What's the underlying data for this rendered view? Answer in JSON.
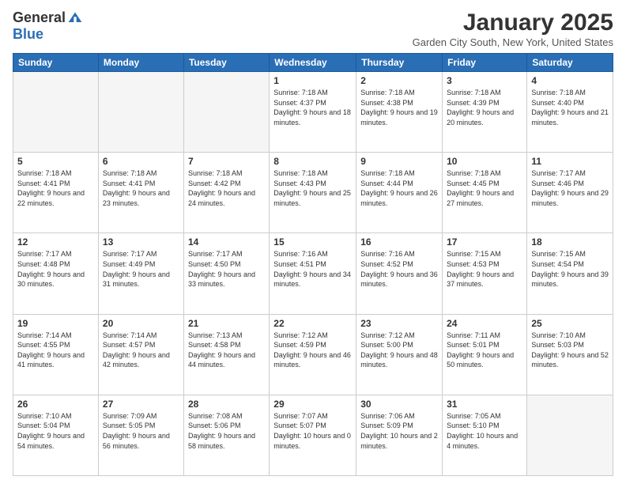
{
  "header": {
    "logo_general": "General",
    "logo_blue": "Blue",
    "month_title": "January 2025",
    "location": "Garden City South, New York, United States"
  },
  "weekdays": [
    "Sunday",
    "Monday",
    "Tuesday",
    "Wednesday",
    "Thursday",
    "Friday",
    "Saturday"
  ],
  "weeks": [
    [
      {
        "day": "",
        "empty": true
      },
      {
        "day": "",
        "empty": true
      },
      {
        "day": "",
        "empty": true
      },
      {
        "day": "1",
        "sunrise": "7:18 AM",
        "sunset": "4:37 PM",
        "daylight": "9 hours and 18 minutes."
      },
      {
        "day": "2",
        "sunrise": "7:18 AM",
        "sunset": "4:38 PM",
        "daylight": "9 hours and 19 minutes."
      },
      {
        "day": "3",
        "sunrise": "7:18 AM",
        "sunset": "4:39 PM",
        "daylight": "9 hours and 20 minutes."
      },
      {
        "day": "4",
        "sunrise": "7:18 AM",
        "sunset": "4:40 PM",
        "daylight": "9 hours and 21 minutes."
      }
    ],
    [
      {
        "day": "5",
        "sunrise": "7:18 AM",
        "sunset": "4:41 PM",
        "daylight": "9 hours and 22 minutes."
      },
      {
        "day": "6",
        "sunrise": "7:18 AM",
        "sunset": "4:41 PM",
        "daylight": "9 hours and 23 minutes."
      },
      {
        "day": "7",
        "sunrise": "7:18 AM",
        "sunset": "4:42 PM",
        "daylight": "9 hours and 24 minutes."
      },
      {
        "day": "8",
        "sunrise": "7:18 AM",
        "sunset": "4:43 PM",
        "daylight": "9 hours and 25 minutes."
      },
      {
        "day": "9",
        "sunrise": "7:18 AM",
        "sunset": "4:44 PM",
        "daylight": "9 hours and 26 minutes."
      },
      {
        "day": "10",
        "sunrise": "7:18 AM",
        "sunset": "4:45 PM",
        "daylight": "9 hours and 27 minutes."
      },
      {
        "day": "11",
        "sunrise": "7:17 AM",
        "sunset": "4:46 PM",
        "daylight": "9 hours and 29 minutes."
      }
    ],
    [
      {
        "day": "12",
        "sunrise": "7:17 AM",
        "sunset": "4:48 PM",
        "daylight": "9 hours and 30 minutes."
      },
      {
        "day": "13",
        "sunrise": "7:17 AM",
        "sunset": "4:49 PM",
        "daylight": "9 hours and 31 minutes."
      },
      {
        "day": "14",
        "sunrise": "7:17 AM",
        "sunset": "4:50 PM",
        "daylight": "9 hours and 33 minutes."
      },
      {
        "day": "15",
        "sunrise": "7:16 AM",
        "sunset": "4:51 PM",
        "daylight": "9 hours and 34 minutes."
      },
      {
        "day": "16",
        "sunrise": "7:16 AM",
        "sunset": "4:52 PM",
        "daylight": "9 hours and 36 minutes."
      },
      {
        "day": "17",
        "sunrise": "7:15 AM",
        "sunset": "4:53 PM",
        "daylight": "9 hours and 37 minutes."
      },
      {
        "day": "18",
        "sunrise": "7:15 AM",
        "sunset": "4:54 PM",
        "daylight": "9 hours and 39 minutes."
      }
    ],
    [
      {
        "day": "19",
        "sunrise": "7:14 AM",
        "sunset": "4:55 PM",
        "daylight": "9 hours and 41 minutes."
      },
      {
        "day": "20",
        "sunrise": "7:14 AM",
        "sunset": "4:57 PM",
        "daylight": "9 hours and 42 minutes."
      },
      {
        "day": "21",
        "sunrise": "7:13 AM",
        "sunset": "4:58 PM",
        "daylight": "9 hours and 44 minutes."
      },
      {
        "day": "22",
        "sunrise": "7:12 AM",
        "sunset": "4:59 PM",
        "daylight": "9 hours and 46 minutes."
      },
      {
        "day": "23",
        "sunrise": "7:12 AM",
        "sunset": "5:00 PM",
        "daylight": "9 hours and 48 minutes."
      },
      {
        "day": "24",
        "sunrise": "7:11 AM",
        "sunset": "5:01 PM",
        "daylight": "9 hours and 50 minutes."
      },
      {
        "day": "25",
        "sunrise": "7:10 AM",
        "sunset": "5:03 PM",
        "daylight": "9 hours and 52 minutes."
      }
    ],
    [
      {
        "day": "26",
        "sunrise": "7:10 AM",
        "sunset": "5:04 PM",
        "daylight": "9 hours and 54 minutes."
      },
      {
        "day": "27",
        "sunrise": "7:09 AM",
        "sunset": "5:05 PM",
        "daylight": "9 hours and 56 minutes."
      },
      {
        "day": "28",
        "sunrise": "7:08 AM",
        "sunset": "5:06 PM",
        "daylight": "9 hours and 58 minutes."
      },
      {
        "day": "29",
        "sunrise": "7:07 AM",
        "sunset": "5:07 PM",
        "daylight": "10 hours and 0 minutes."
      },
      {
        "day": "30",
        "sunrise": "7:06 AM",
        "sunset": "5:09 PM",
        "daylight": "10 hours and 2 minutes."
      },
      {
        "day": "31",
        "sunrise": "7:05 AM",
        "sunset": "5:10 PM",
        "daylight": "10 hours and 4 minutes."
      },
      {
        "day": "",
        "empty": true
      }
    ]
  ]
}
